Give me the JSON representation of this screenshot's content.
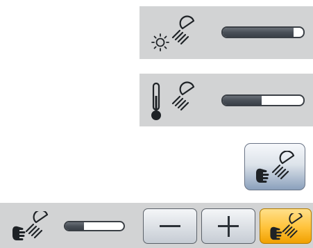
{
  "controls": {
    "brightness": {
      "icon": "brightness-lamp-icon",
      "level": 0.88
    },
    "color_temperature": {
      "icon": "thermometer-lamp-icon",
      "level": 0.48
    },
    "hand_light_toggle": {
      "icon": "hand-lamp-icon"
    },
    "bottom_bar": {
      "icon": "hand-lamp-icon",
      "level": 0.32,
      "decrease_icon": "minus-icon",
      "increase_icon": "plus-icon",
      "active_icon": "hand-lamp-icon"
    }
  },
  "colors": {
    "panel_background": "#d2d3d4",
    "bar_fill": "#4a5058",
    "active_button": "#ffc23a",
    "toggle_button": "#8aa0bc"
  }
}
